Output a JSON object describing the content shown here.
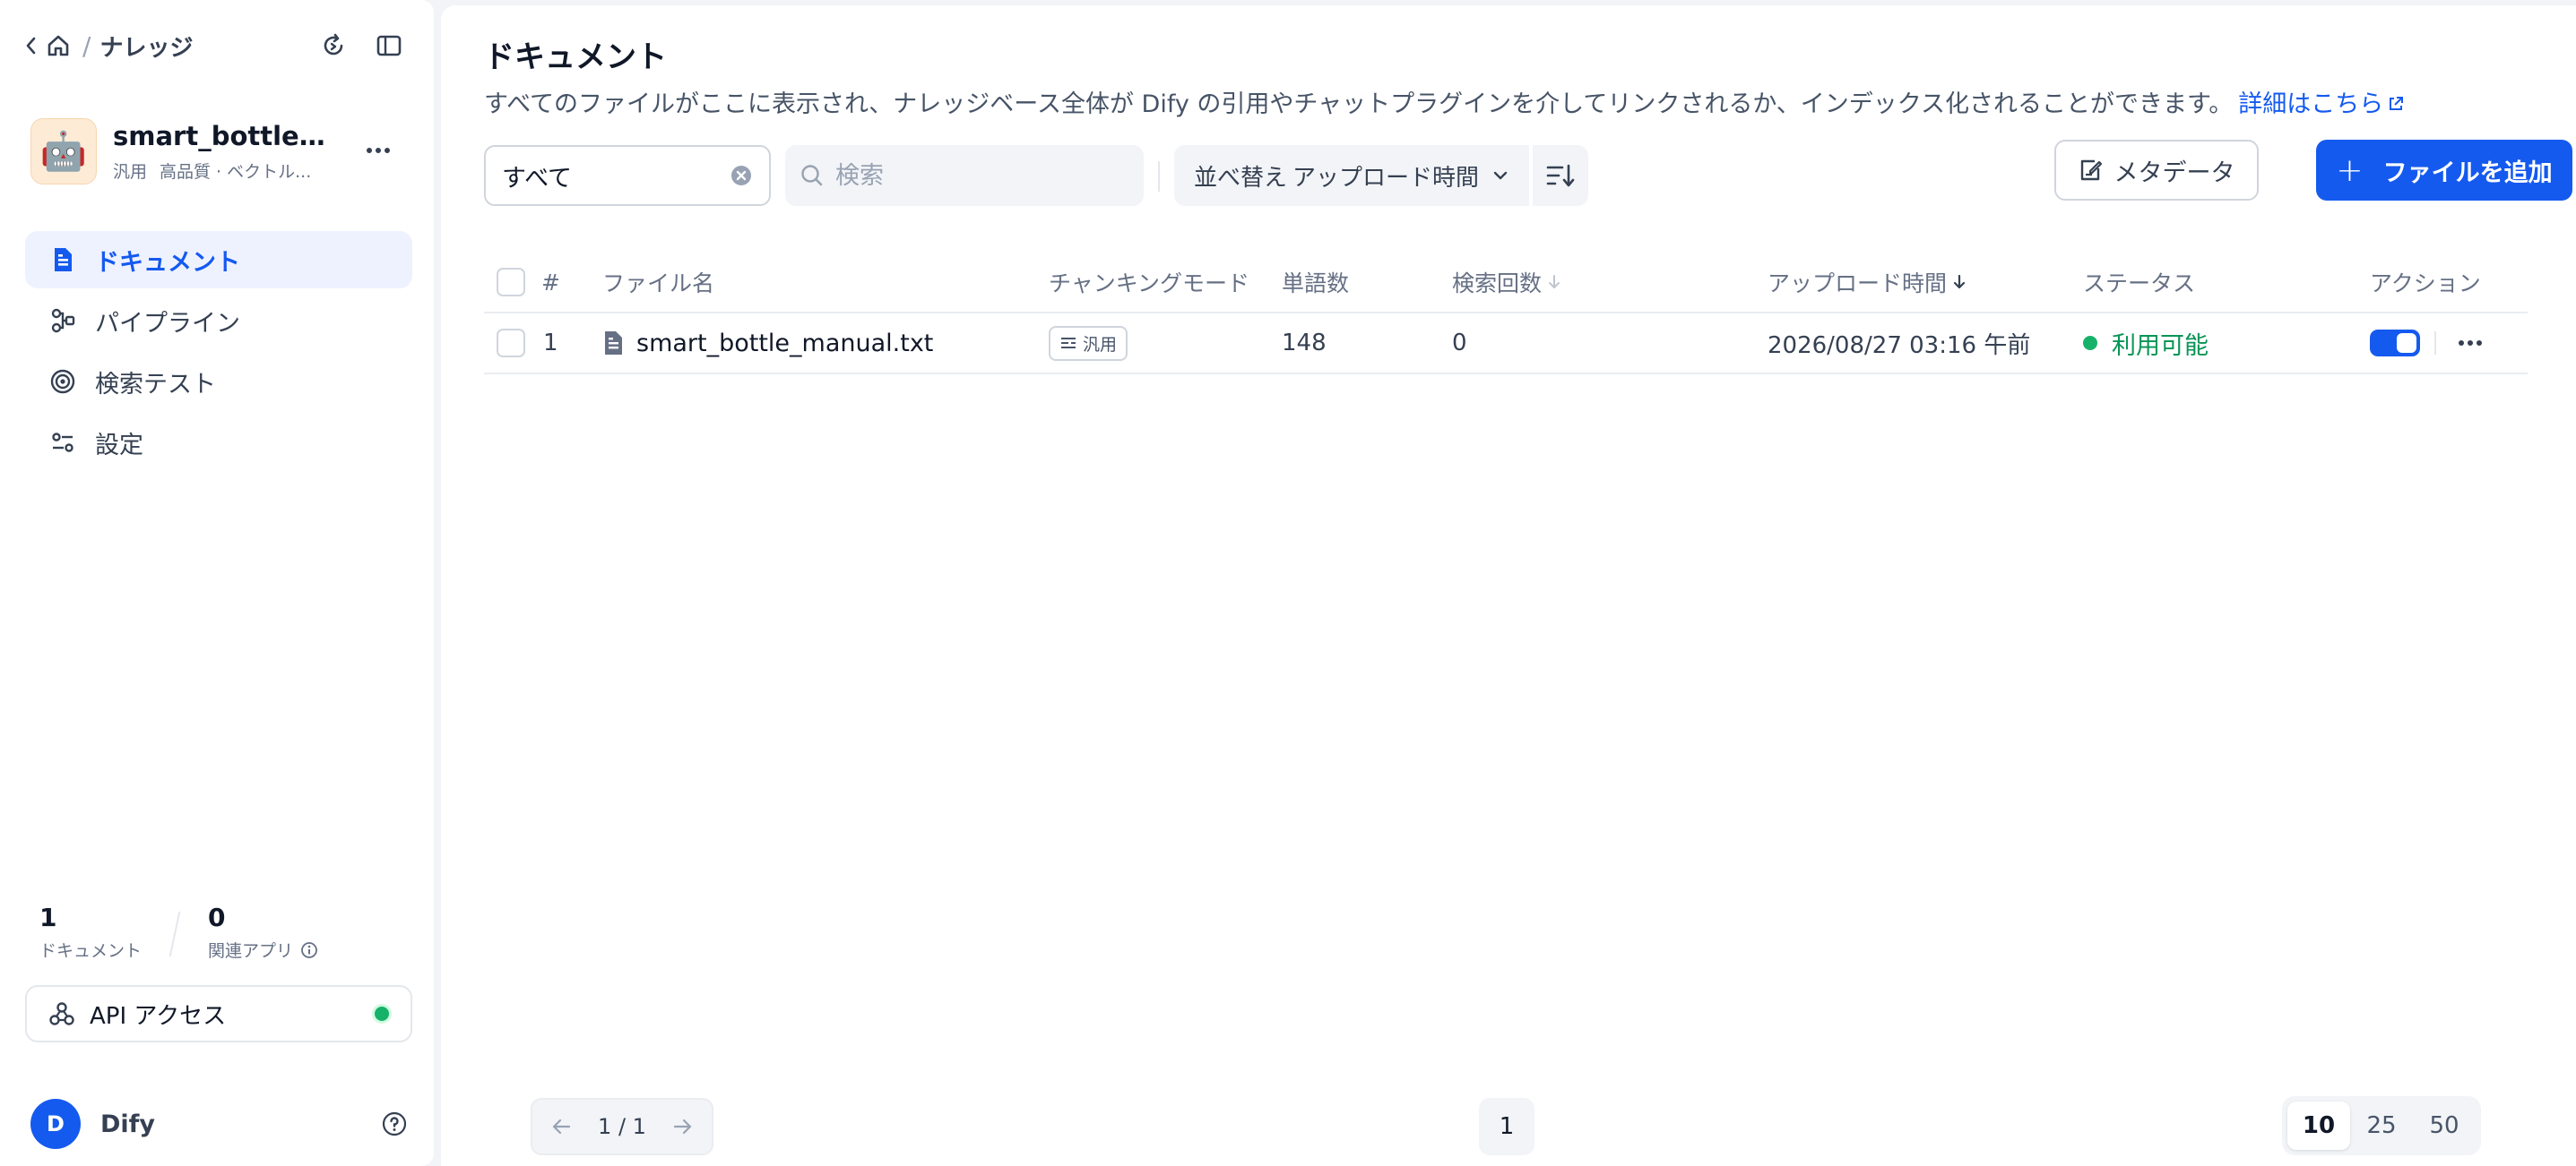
{
  "breadcrumb": {
    "section": "ナレッジ"
  },
  "dataset": {
    "name": "smart_bottle_...",
    "type": "汎用",
    "index": "高品質 · ベクトル...",
    "avatar_emoji": "🤖"
  },
  "nav": [
    {
      "label": "ドキュメント",
      "icon": "document-icon",
      "active": true
    },
    {
      "label": "パイプライン",
      "icon": "pipeline-icon",
      "active": false
    },
    {
      "label": "検索テスト",
      "icon": "target-icon",
      "active": false
    },
    {
      "label": "設定",
      "icon": "settings-icon",
      "active": false
    }
  ],
  "stats": {
    "docs_count": "1",
    "docs_label": "ドキュメント",
    "apps_count": "0",
    "apps_label": "関連アプリ"
  },
  "api": {
    "label": "API アクセス",
    "status_color": "#17b26a"
  },
  "user": {
    "initial": "D",
    "name": "Dify"
  },
  "page": {
    "title": "ドキュメント",
    "description": "すべてのファイルがここに表示され、ナレッジベース全体が Dify の引用やチャットプラグインを介してリンクされるか、インデックス化されることができます。",
    "link": "詳細はこちら"
  },
  "toolbar": {
    "filter_value": "すべて",
    "search_placeholder": "検索",
    "sort_prefix": "並べ替え",
    "sort_value": "アップロード時間",
    "metadata_label": "メタデータ",
    "add_label": "ファイルを追加"
  },
  "table": {
    "headers": {
      "index": "#",
      "name": "ファイル名",
      "chunking": "チャンキングモード",
      "words": "単語数",
      "hits": "検索回数",
      "uploaded": "アップロード時間",
      "status": "ステータス",
      "actions": "アクション"
    },
    "rows": [
      {
        "index": "1",
        "name": "smart_bottle_manual.txt",
        "chunking": "汎用",
        "words": "148",
        "hits": "0",
        "uploaded": "2026/08/27 03:16 午前",
        "status": "利用可能",
        "enabled": true
      }
    ]
  },
  "pagination": {
    "page_indicator": "1 / 1",
    "current_page": "1",
    "page_sizes": [
      "10",
      "25",
      "50"
    ],
    "selected_size": "10"
  },
  "colors": {
    "accent": "#155aef",
    "success": "#17b26a"
  }
}
